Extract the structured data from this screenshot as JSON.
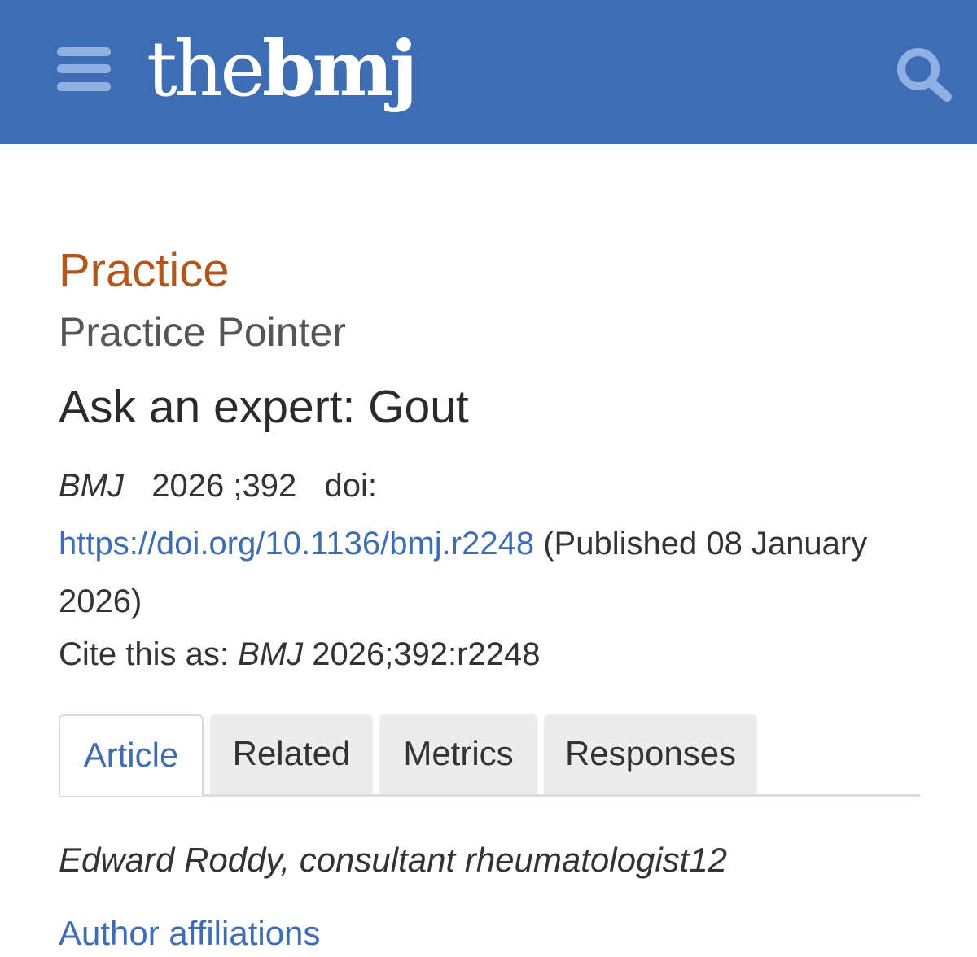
{
  "header": {
    "logo_light": "the",
    "logo_bold": "bmj",
    "bg_color": "#3f6db3",
    "menu_icon": "hamburger-menu-icon",
    "search_icon": "search-icon"
  },
  "article": {
    "section": "Practice",
    "subsection": "Practice Pointer",
    "title": "Ask an expert: Gout",
    "journal": "BMJ",
    "year": "2026",
    "volume_sep": ";",
    "volume": "392",
    "doi_label": "doi:",
    "doi_url": "https://doi.org/10.1136/bmj.r2248",
    "published": "(Published 08 January 2026)",
    "cite_label": "Cite this as:",
    "cite_journal": "BMJ",
    "cite_ref": "2026;392:r2248",
    "author": "Edward Roddy, consultant rheumatologist12",
    "affiliations_link": "Author affiliations"
  },
  "tabs": [
    {
      "label": "Article",
      "active": true
    },
    {
      "label": "Related",
      "active": false
    },
    {
      "label": "Metrics",
      "active": false
    },
    {
      "label": "Responses",
      "active": false
    }
  ],
  "colors": {
    "section": "#b3561d",
    "link": "#3f6db3",
    "menu_icon": "#8fb0e3"
  }
}
